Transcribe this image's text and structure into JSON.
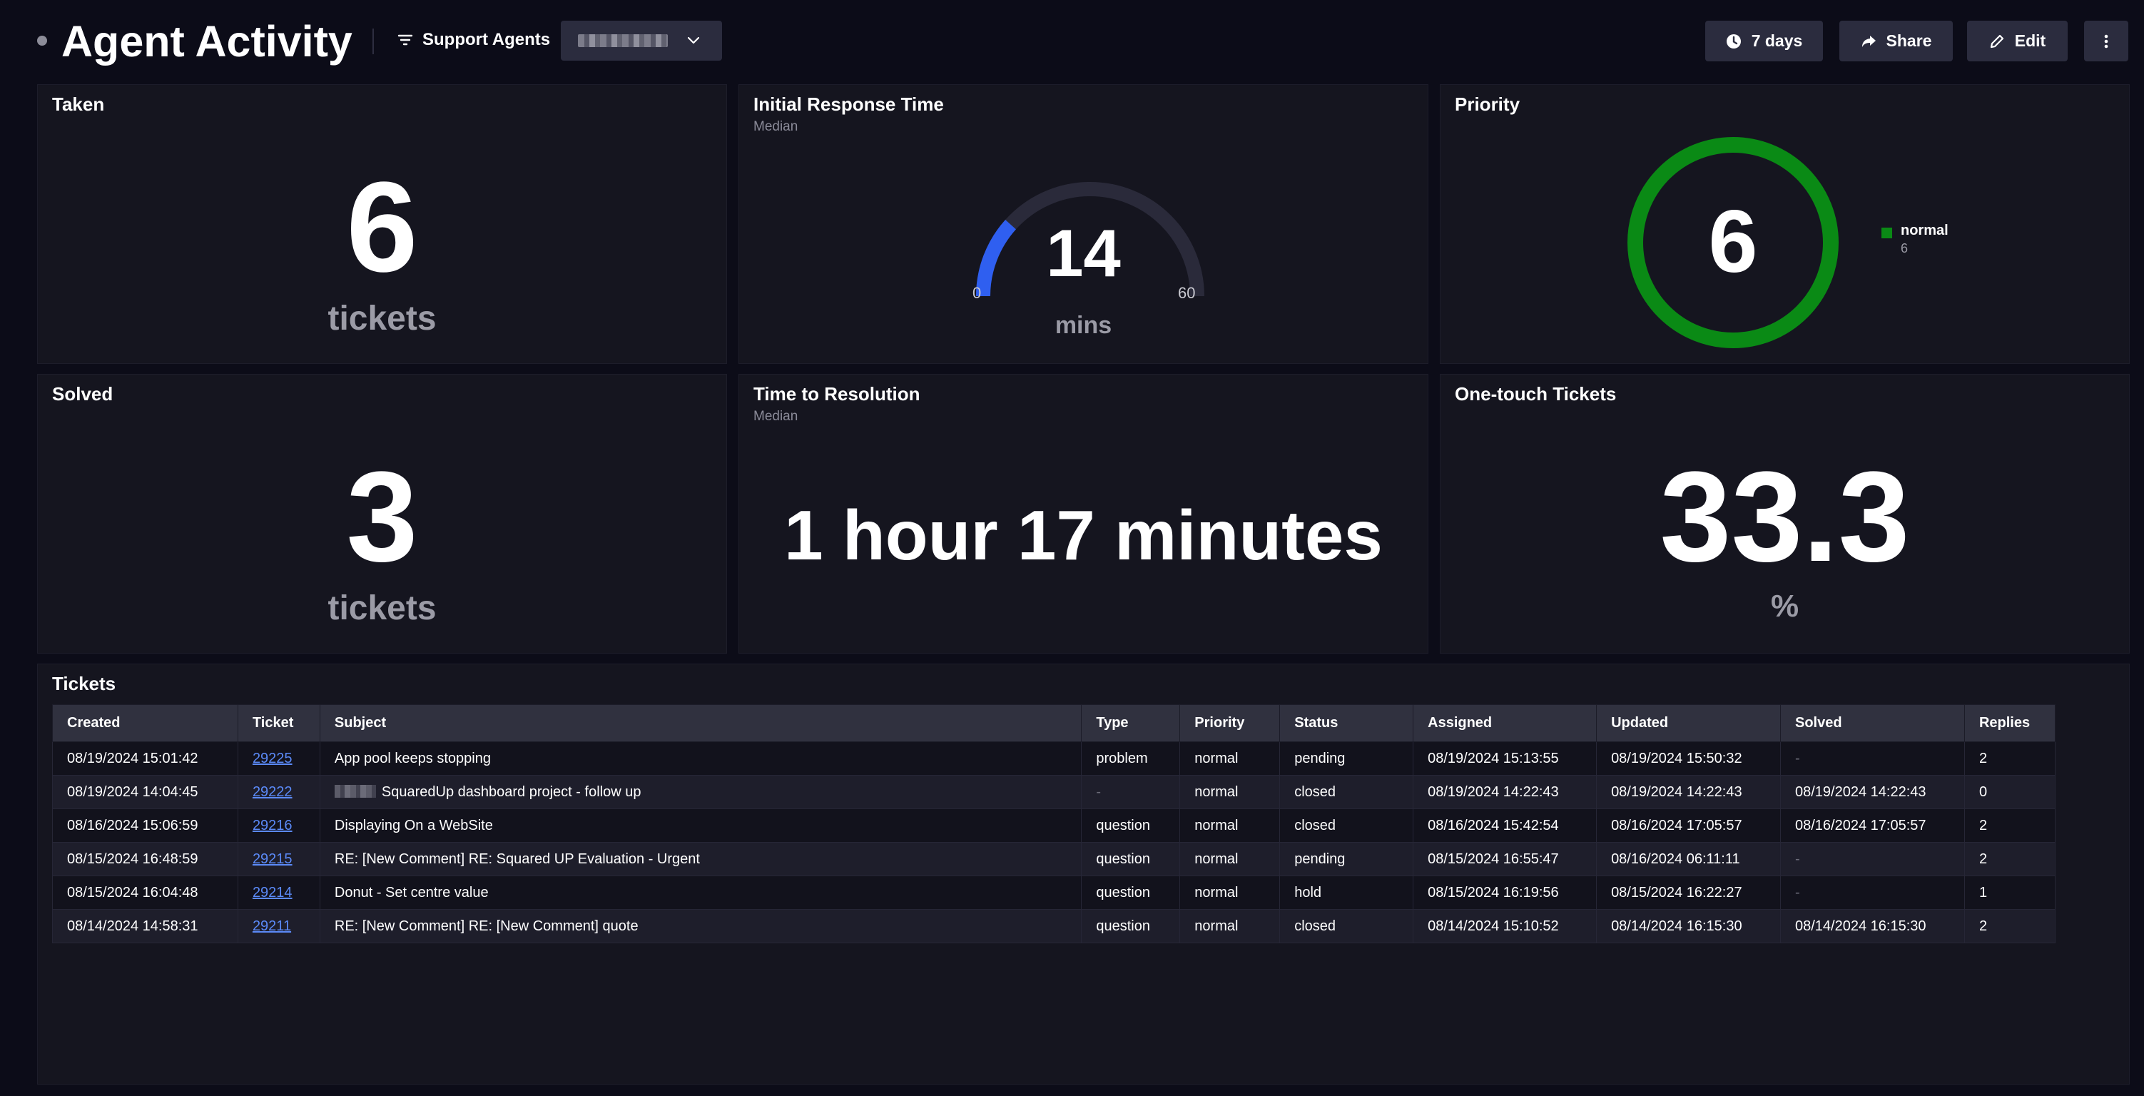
{
  "header": {
    "title": "Agent Activity",
    "filter_label": "Support Agents",
    "buttons": {
      "range": "7 days",
      "share": "Share",
      "edit": "Edit"
    }
  },
  "tiles": {
    "taken": {
      "title": "Taken",
      "value": "6",
      "unit": "tickets"
    },
    "initial_response": {
      "title": "Initial Response Time",
      "subtitle": "Median",
      "value": "14",
      "unit": "mins",
      "gauge_min": "0",
      "gauge_max": "60",
      "gauge_value": 14,
      "gauge_color": "#2f5ff0"
    },
    "priority": {
      "title": "Priority",
      "total": "6",
      "legend": [
        {
          "name": "normal",
          "value": "6",
          "color": "#0a8a15"
        }
      ]
    },
    "solved": {
      "title": "Solved",
      "value": "3",
      "unit": "tickets"
    },
    "resolution": {
      "title": "Time to Resolution",
      "subtitle": "Median",
      "value": "1 hour 17 minutes"
    },
    "one_touch": {
      "title": "One-touch Tickets",
      "value": "33.3",
      "unit": "%"
    }
  },
  "tickets": {
    "title": "Tickets",
    "columns": [
      "Created",
      "Ticket",
      "Subject",
      "Type",
      "Priority",
      "Status",
      "Assigned",
      "Updated",
      "Solved",
      "Replies"
    ],
    "rows": [
      {
        "created": "08/19/2024 15:01:42",
        "ticket": "29225",
        "subject": "App pool keeps stopping",
        "type": "problem",
        "priority": "normal",
        "status": "pending",
        "assigned": "08/19/2024 15:13:55",
        "updated": "08/19/2024 15:50:32",
        "solved": "-",
        "replies": "2"
      },
      {
        "created": "08/19/2024 14:04:45",
        "ticket": "29222",
        "subject": "SquaredUp dashboard project - follow up",
        "type": "-",
        "priority": "normal",
        "status": "closed",
        "assigned": "08/19/2024 14:22:43",
        "updated": "08/19/2024 14:22:43",
        "solved": "08/19/2024 14:22:43",
        "replies": "0"
      },
      {
        "created": "08/16/2024 15:06:59",
        "ticket": "29216",
        "subject": "Displaying On a WebSite",
        "type": "question",
        "priority": "normal",
        "status": "closed",
        "assigned": "08/16/2024 15:42:54",
        "updated": "08/16/2024 17:05:57",
        "solved": "08/16/2024 17:05:57",
        "replies": "2"
      },
      {
        "created": "08/15/2024 16:48:59",
        "ticket": "29215",
        "subject": "RE: [New Comment] RE: Squared UP Evaluation - Urgent",
        "type": "question",
        "priority": "normal",
        "status": "pending",
        "assigned": "08/15/2024 16:55:47",
        "updated": "08/16/2024 06:11:11",
        "solved": "-",
        "replies": "2"
      },
      {
        "created": "08/15/2024 16:04:48",
        "ticket": "29214",
        "subject": "Donut - Set centre value",
        "type": "question",
        "priority": "normal",
        "status": "hold",
        "assigned": "08/15/2024 16:19:56",
        "updated": "08/15/2024 16:22:27",
        "solved": "-",
        "replies": "1"
      },
      {
        "created": "08/14/2024 14:58:31",
        "ticket": "29211",
        "subject": "RE: [New Comment] RE: [New Comment] quote",
        "type": "question",
        "priority": "normal",
        "status": "closed",
        "assigned": "08/14/2024 15:10:52",
        "updated": "08/14/2024 16:15:30",
        "solved": "08/14/2024 16:15:30",
        "replies": "2"
      }
    ]
  }
}
